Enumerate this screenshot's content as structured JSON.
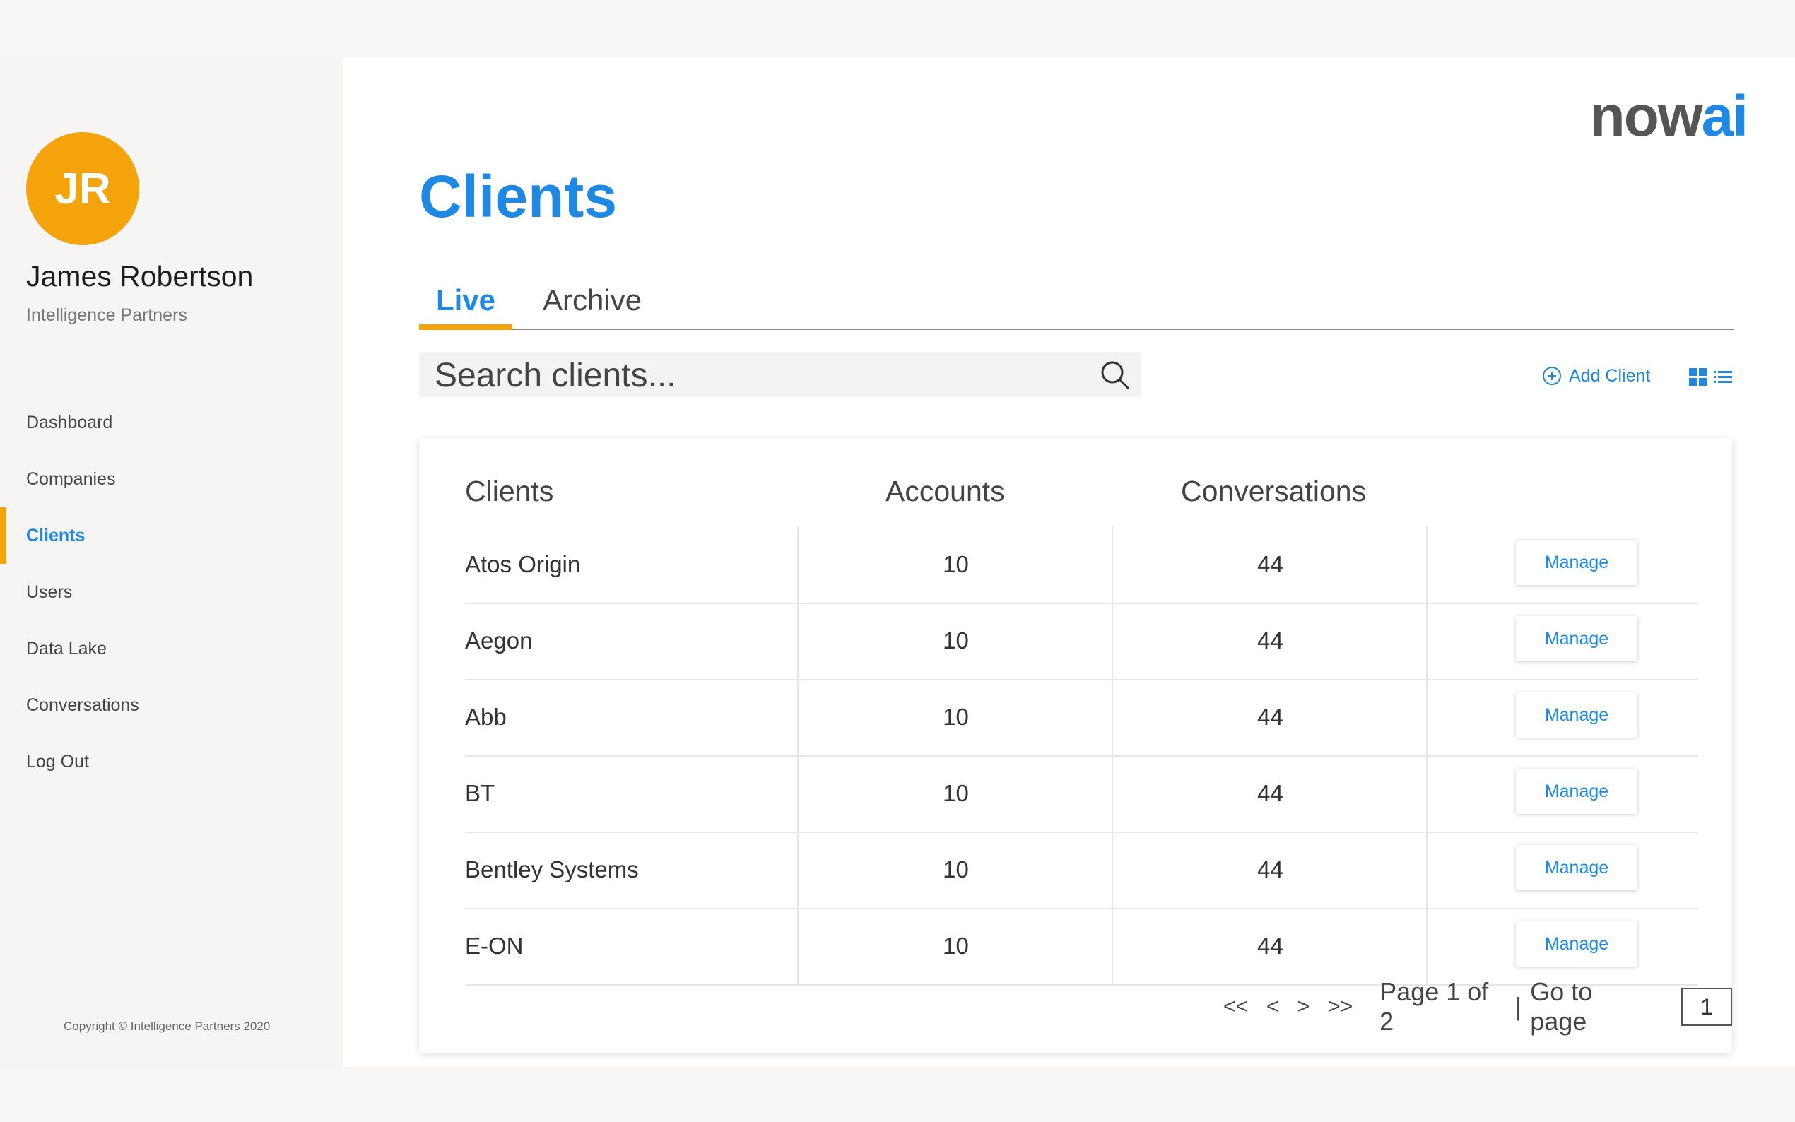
{
  "user": {
    "initials": "JR",
    "name": "James Robertson",
    "organization": "Intelligence Partners"
  },
  "nav": [
    {
      "label": "Dashboard",
      "active": false
    },
    {
      "label": "Companies",
      "active": false
    },
    {
      "label": "Clients",
      "active": true
    },
    {
      "label": "Users",
      "active": false
    },
    {
      "label": "Data Lake",
      "active": false
    },
    {
      "label": "Conversations",
      "active": false
    },
    {
      "label": "Log Out",
      "active": false
    }
  ],
  "copyright": "Copyright © Intelligence Partners 2020",
  "logo": {
    "part1": "now",
    "part2": "ai"
  },
  "page_title": "Clients",
  "tabs": {
    "live": "Live",
    "archive": "Archive"
  },
  "search": {
    "placeholder": "Search clients..."
  },
  "toolbar": {
    "add_client": "Add Client"
  },
  "table": {
    "headers": {
      "clients": "Clients",
      "accounts": "Accounts",
      "conversations": "Conversations"
    },
    "manage_label": "Manage",
    "rows": [
      {
        "client": "Atos Origin",
        "accounts": "10",
        "conversations": "44"
      },
      {
        "client": "Aegon",
        "accounts": "10",
        "conversations": "44"
      },
      {
        "client": "Abb",
        "accounts": "10",
        "conversations": "44"
      },
      {
        "client": "BT",
        "accounts": "10",
        "conversations": "44"
      },
      {
        "client": "Bentley Systems",
        "accounts": "10",
        "conversations": "44"
      },
      {
        "client": "E-ON",
        "accounts": "10",
        "conversations": "44"
      }
    ]
  },
  "pagination": {
    "first": "<<",
    "prev": "<",
    "next": ">",
    "last": ">>",
    "page_info": "Page 1 of 2",
    "separator": "|",
    "goto_label": "Go to page",
    "goto_value": "1"
  },
  "colors": {
    "accent": "#1e88e5",
    "highlight": "#f5a30a"
  },
  "icons": {
    "search": "search-icon",
    "add": "plus-circle-icon",
    "grid": "grid-view-icon",
    "list": "list-view-icon"
  }
}
